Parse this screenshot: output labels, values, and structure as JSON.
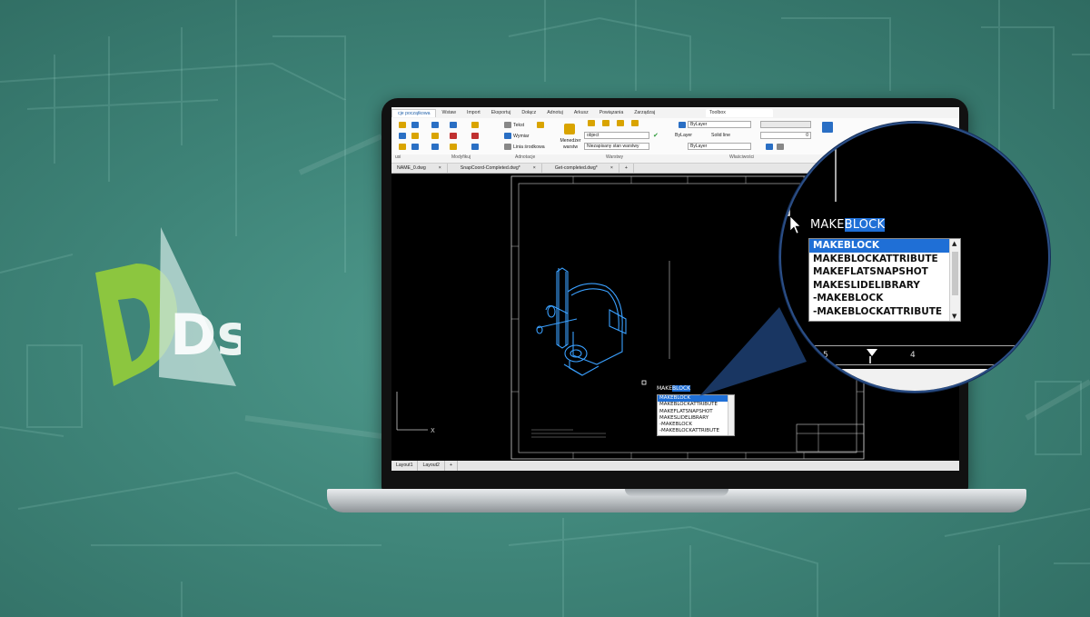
{
  "logo": {
    "letters": "Ds",
    "brand_colors": [
      "#8cc63f",
      "#b9d7d3"
    ]
  },
  "ribbon": {
    "tabs": [
      "cje początkowa",
      "Wstaw",
      "Import",
      "Eksportuj",
      "Dołącz",
      "Adnotuj",
      "Arkusz",
      "Powiązania",
      "Zarządzaj"
    ],
    "active_tab": "cje początkowa",
    "toolbox_tab": "Toolbox",
    "text_tool": "Tekst",
    "dimension_tool": "Wymiar",
    "centerline_tool": "Linia środkowa",
    "layer_manager": "Menedżer warstw",
    "layer_combo": "object",
    "layer_state_combo": "Niezapisany stan warstwy",
    "color_combo": "ByLayer",
    "linetype_combo": "ByLayer",
    "linetype_label": "Solid line",
    "lineweight_combo": "ByLayer",
    "transparency_value": "0",
    "groups": [
      "usi",
      "Modyfikuj",
      "Adnotacje",
      "Warstwy",
      "Właściwości"
    ]
  },
  "document_tabs": [
    {
      "label": "NAME_0.dwg",
      "close": "×"
    },
    {
      "label": "SnapCoord-Completed.dwg*",
      "close": "×"
    },
    {
      "label": "Get-completed.dwg*",
      "close": "×"
    }
  ],
  "add_tab": "+",
  "layout_tabs": [
    "Layout1",
    "Layout2",
    "+"
  ],
  "command": {
    "typed": "MAKE",
    "completion": "BLOCK"
  },
  "autocomplete": {
    "items": [
      "MAKEBLOCK",
      "MAKEBLOCKATTRIBUTE",
      "MAKEFLATSNAPSHOT",
      "MAKESLIDELIBRARY",
      "-MAKEBLOCK",
      "-MAKEBLOCKATTRIBUTE"
    ],
    "selected": "MAKEBLOCK"
  },
  "magnifier": {
    "command": {
      "typed": "MAKE",
      "completion": "BLOCK"
    },
    "items": [
      "MAKEBLOCK",
      "MAKEBLOCKATTRIBUTE",
      "MAKEFLATSNAPSHOT",
      "MAKESLIDELIBRARY",
      "-MAKEBLOCK",
      "-MAKEBLOCKATTRIBUTE"
    ],
    "border_numbers": [
      "5",
      "4"
    ]
  },
  "ucs": {
    "x_label": "X"
  },
  "colors": {
    "highlight": "#1f6fd6",
    "drawing": "#3aa0ff",
    "background": "#3f8579"
  }
}
